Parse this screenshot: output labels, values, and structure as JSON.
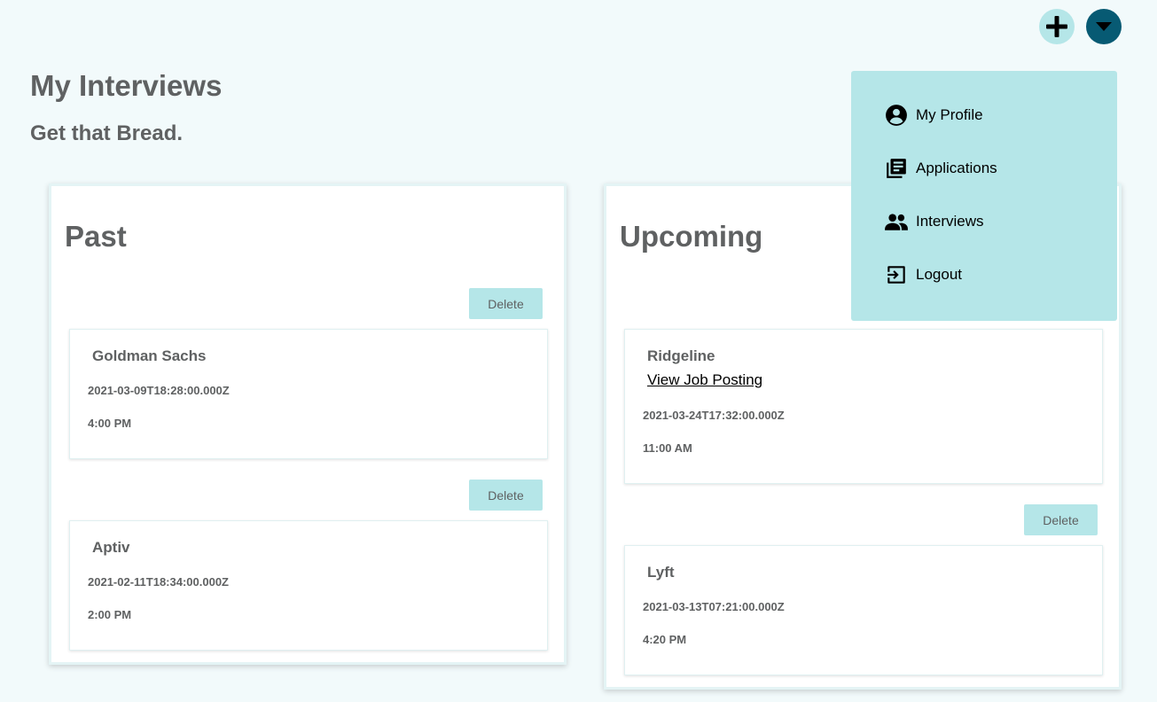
{
  "header": {
    "add_icon": "plus-icon",
    "menu_icon": "caret-down-icon"
  },
  "page": {
    "title": "My Interviews",
    "subtitle": "Get that Bread."
  },
  "past": {
    "title": "Past",
    "delete_label": "Delete",
    "interviews": [
      {
        "company": "Goldman Sachs",
        "date": "2021-03-09T18:28:00.000Z",
        "time": "4:00 PM"
      },
      {
        "company": "Aptiv",
        "date": "2021-02-11T18:34:00.000Z",
        "time": "2:00 PM"
      }
    ]
  },
  "upcoming": {
    "title": "Upcoming",
    "delete_label": "Delete",
    "interviews": [
      {
        "company": "Ridgeline",
        "link": "View Job Posting",
        "date": "2021-03-24T17:32:00.000Z",
        "time": "11:00 AM"
      },
      {
        "company": "Lyft",
        "date": "2021-03-13T07:21:00.000Z",
        "time": "4:20 PM"
      }
    ]
  },
  "dropdown": {
    "items": [
      {
        "label": "My Profile",
        "icon": "account-circle-icon"
      },
      {
        "label": "Applications",
        "icon": "library-books-icon"
      },
      {
        "label": "Interviews",
        "icon": "people-icon"
      },
      {
        "label": "Logout",
        "icon": "logout-icon"
      }
    ]
  },
  "colors": {
    "background": "#f2fafb",
    "accent": "#b5e6e8",
    "menu_button": "#075a73",
    "text": "#5f6162"
  }
}
